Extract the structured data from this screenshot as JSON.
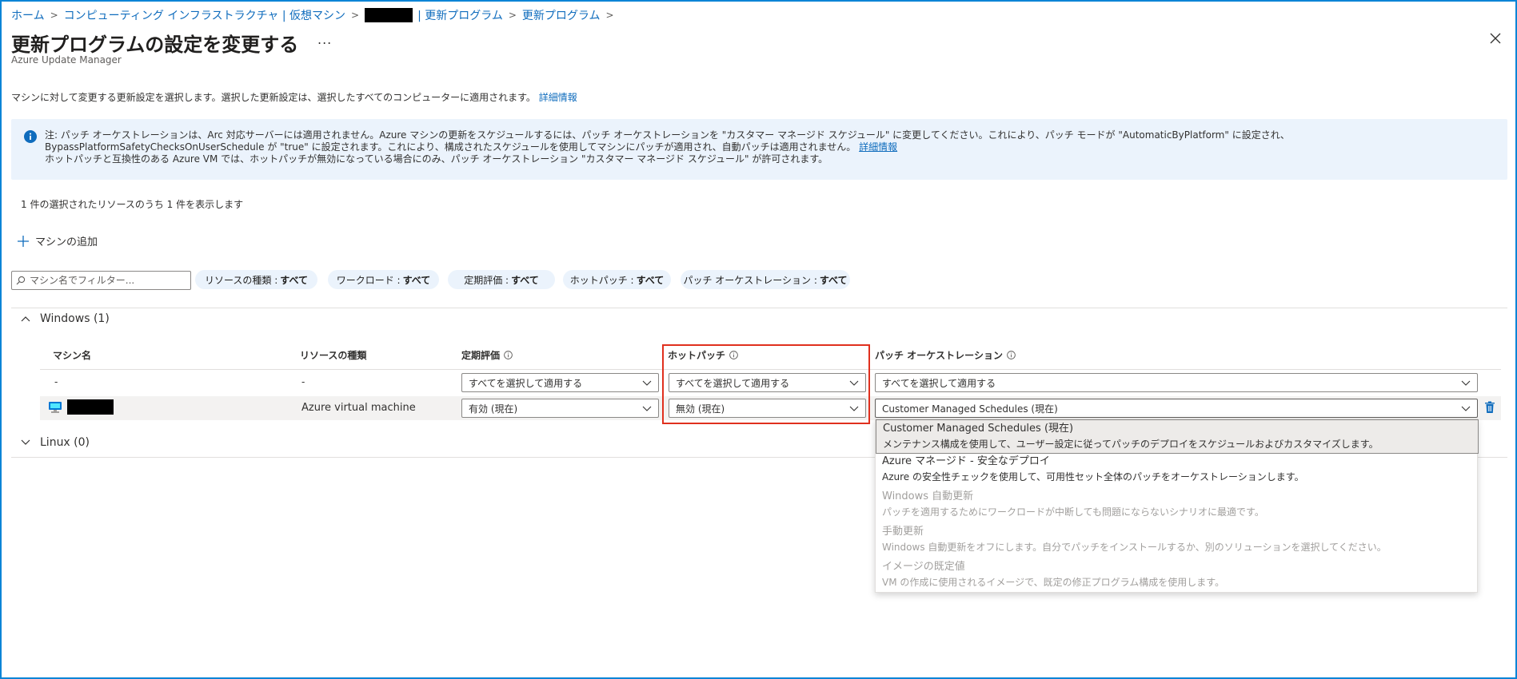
{
  "breadcrumb": {
    "items": [
      "ホーム",
      "コンピューティング インフラストラクチャ | 仮想マシン",
      "| 更新プログラム",
      "更新プログラム"
    ],
    "separator": ">"
  },
  "page": {
    "title": "更新プログラムの設定を変更する",
    "more": "...",
    "subtitle": "Azure Update Manager"
  },
  "intro": {
    "text": "マシンに対して変更する更新設定を選択します。選択した更新設定は、選択したすべてのコンピューターに適用されます。",
    "link": "詳細情報"
  },
  "notice": {
    "line1": "注: パッチ オーケストレーションは、Arc 対応サーバーには適用されません。Azure マシンの更新をスケジュールするには、パッチ オーケストレーションを \"カスタマー マネージド スケジュール\" に変更してください。これにより、パッチ モードが \"AutomaticByPlatform\" に設定され、BypassPlatformSafetyChecksOnUserSchedule が \"true\" に設定されます。これにより、構成されたスケジュールを使用してマシンにパッチが適用され、自動パッチは適用されません。",
    "link": "詳細情報",
    "line2": "ホットパッチと互換性のある Azure VM では、ホットパッチが無効になっている場合にのみ、パッチ オーケストレーション \"カスタマー マネージド スケジュール\" が許可されます。"
  },
  "count_text": "1 件の選択されたリソースのうち 1 件を表示します",
  "add_machine": "マシンの追加",
  "filter": {
    "placeholder": "マシン名でフィルター..."
  },
  "pills": [
    {
      "label": "リソースの種類 :",
      "value": "すべて"
    },
    {
      "label": "ワークロード :",
      "value": "すべて"
    },
    {
      "label": "定期評価 :",
      "value": "すべて"
    },
    {
      "label": "ホットパッチ :",
      "value": "すべて"
    },
    {
      "label": "パッチ オーケストレーション :",
      "value": "すべて"
    }
  ],
  "groups": {
    "windows": "Windows (1)",
    "linux": "Linux (0)"
  },
  "columns": {
    "name": "マシン名",
    "resource_type": "リソースの種類",
    "periodic": "定期評価",
    "hotpatch": "ホットパッチ",
    "orchestration": "パッチ オーケストレーション"
  },
  "bulk_row": {
    "name": "-",
    "resource_type": "-",
    "periodic": "すべてを選択して適用する",
    "hotpatch": "すべてを選択して適用する",
    "orchestration": "すべてを選択して適用する"
  },
  "vm_row": {
    "resource_type": "Azure virtual machine",
    "periodic": "有効 (現在)",
    "hotpatch": "無効 (現在)",
    "orchestration": "Customer Managed Schedules (現在)"
  },
  "menu_options": [
    {
      "title": "Customer Managed Schedules (現在)",
      "desc": "メンテナンス構成を使用して、ユーザー設定に従ってパッチのデプロイをスケジュールおよびカスタマイズします。",
      "state": "selected"
    },
    {
      "title": "Azure マネージド - 安全なデプロイ",
      "desc": "Azure の安全性チェックを使用して、可用性セット全体のパッチをオーケストレーションします。",
      "state": "enabled"
    },
    {
      "title": "Windows 自動更新",
      "desc": "パッチを適用するためにワークロードが中断しても問題にならないシナリオに最適です。",
      "state": "disabled"
    },
    {
      "title": "手動更新",
      "desc": "Windows 自動更新をオフにします。自分でパッチをインストールするか、別のソリューションを選択してください。",
      "state": "disabled"
    },
    {
      "title": "イメージの既定値",
      "desc": "VM の作成に使用されるイメージで、既定の修正プログラム構成を使用します。",
      "state": "disabled"
    }
  ],
  "colors": {
    "link": "#0f6cbd",
    "info_bg": "#ebf3fc",
    "highlight": "#e0301e",
    "frame": "#0a84d6"
  }
}
